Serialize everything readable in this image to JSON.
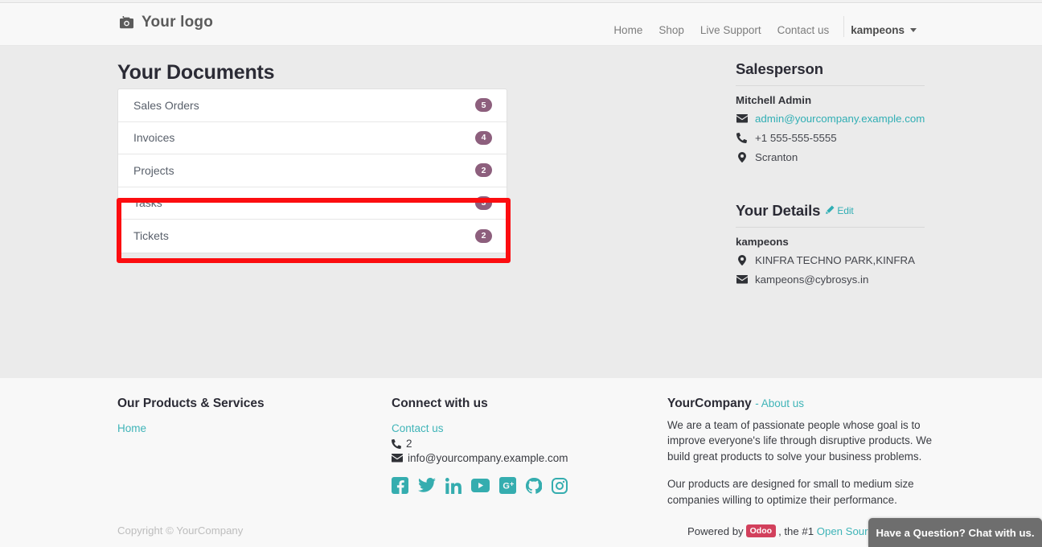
{
  "header": {
    "logo_text": "Your logo",
    "logo_icon": "camera-icon",
    "nav": [
      {
        "label": "Home"
      },
      {
        "label": "Shop"
      },
      {
        "label": "Live Support"
      },
      {
        "label": "Contact us"
      }
    ],
    "user_menu": {
      "label": "kampeons",
      "icon": "chevron-down-icon"
    }
  },
  "main": {
    "page_title": "Your Documents",
    "documents": [
      {
        "label": "Sales Orders",
        "count": "5"
      },
      {
        "label": "Invoices",
        "count": "4"
      },
      {
        "label": "Projects",
        "count": "2"
      },
      {
        "label": "Tasks",
        "count": "3"
      },
      {
        "label": "Tickets",
        "count": "2"
      }
    ],
    "annotation": {
      "color": "#fc0d10",
      "covers": "Projects and Tasks rows"
    },
    "salesperson": {
      "heading": "Salesperson",
      "name": "Mitchell Admin",
      "email": "admin@yourcompany.example.com",
      "phone": "+1 555-555-5555",
      "city": "Scranton"
    },
    "your_details": {
      "heading": "Your Details",
      "edit_label": "Edit",
      "name": "kampeons",
      "address": "KINFRA TECHNO PARK,KINFRA",
      "email": "kampeons@cybrosys.in"
    }
  },
  "footer": {
    "products_services": {
      "title": "Our Products & Services",
      "links": [
        {
          "label": "Home"
        }
      ]
    },
    "connect": {
      "title": "Connect with us",
      "contact_label": "Contact us",
      "phone": "2",
      "email": "info@yourcompany.example.com",
      "social": [
        {
          "name": "facebook-icon"
        },
        {
          "name": "twitter-icon"
        },
        {
          "name": "linkedin-icon"
        },
        {
          "name": "youtube-icon"
        },
        {
          "name": "googleplus-icon"
        },
        {
          "name": "github-icon"
        },
        {
          "name": "instagram-icon"
        }
      ]
    },
    "company": {
      "name": "YourCompany",
      "about_label": "- About us",
      "paragraph1": "We are a team of passionate people whose goal is to improve everyone's life through disruptive products. We build great products to solve your business problems.",
      "paragraph2": "Our products are designed for small to medium size companies willing to optimize their performance."
    },
    "bottom": {
      "copyright": "Copyright © YourCompany",
      "powered_prefix": "Powered by",
      "odoo_badge": "Odoo",
      "powered_middle": ", the #1",
      "powered_link": "Open Source eCo"
    }
  },
  "chat_widget": {
    "label": "Have a Question? Chat with us."
  },
  "colors": {
    "accent_teal": "#30aeb4",
    "badge_purple": "#8d5f7d",
    "annotation_red": "#fc0d10",
    "odoo_red": "#d2405c",
    "page_bg": "#ebebeb",
    "footer_bg": "#f8f8f8"
  }
}
